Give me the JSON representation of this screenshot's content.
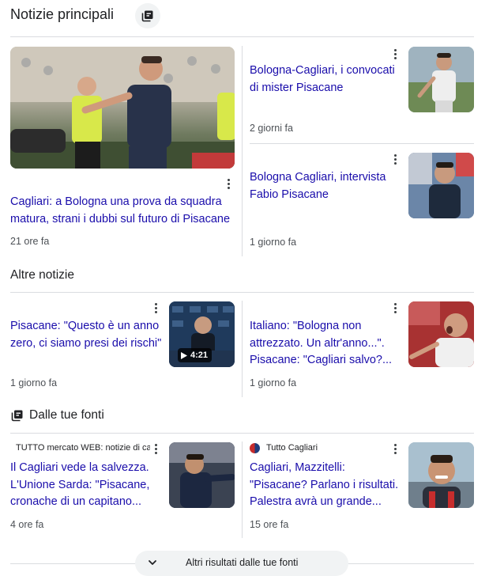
{
  "sections": {
    "top": "Notizie principali",
    "other": "Altre notizie",
    "sources": "Dalle tue fonti"
  },
  "articles": [
    {
      "headline": "Cagliari: a Bologna una prova da squadra matura, strani i dubbi sul futuro di Pisacane",
      "time": "21 ore fa"
    },
    {
      "headline": "Bologna-Cagliari, i convocati di mister Pisacane",
      "time": "2 giorni fa"
    },
    {
      "headline": "Bologna Cagliari, intervista Fabio Pisacane",
      "time": "1 giorno fa"
    },
    {
      "headline": "Pisacane: \"Questo è un anno zero, ci siamo presi dei rischi\"",
      "time": "1 giorno fa",
      "video_duration": "4:21"
    },
    {
      "headline": "Italiano: \"Bologna non attrezzato. Un altr'anno...\". Pisacane: \"Cagliari salvo?...",
      "time": "1 giorno fa"
    },
    {
      "source": "TUTTO mercato WEB: notizie di ca",
      "headline": "Il Cagliari vede la salvezza. L'Unione Sarda: \"Pisacane, cronache di un capitano...",
      "time": "4 ore fa"
    },
    {
      "source": "Tutto Cagliari",
      "headline": "Cagliari, Mazzitelli: \"Pisacane? Parlano i risultati. Palestra avrà un grande...",
      "time": "15 ore fa"
    }
  ],
  "more_button": "Altri risultati dalle tue fonti",
  "icons": {
    "stack": "stack-icon",
    "menu": "more-vert-icon",
    "chevron": "chevron-down-icon",
    "play": "play-icon"
  },
  "colors": {
    "headline": "#1a0dab",
    "meta": "#4d5156",
    "divider": "#dadce0"
  }
}
